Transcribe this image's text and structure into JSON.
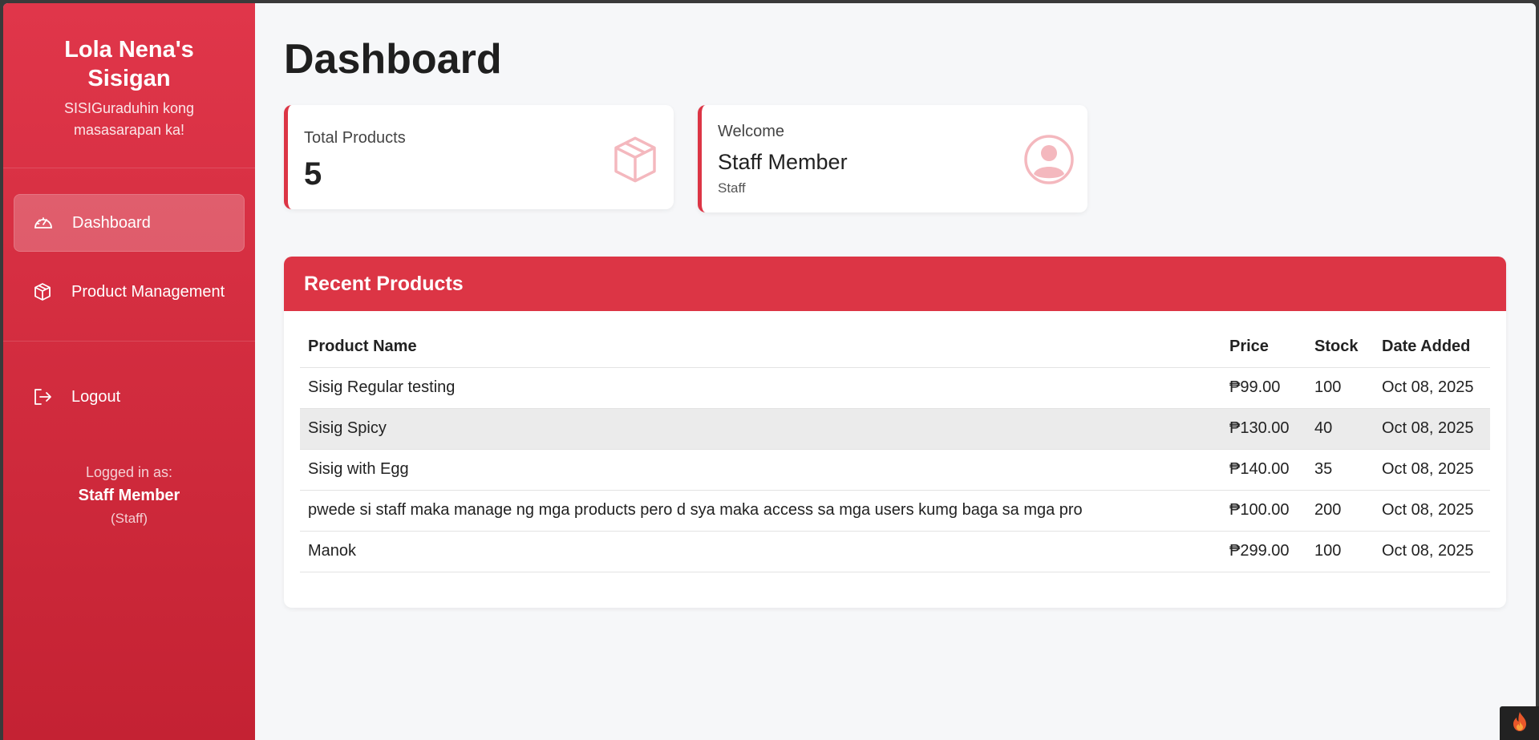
{
  "brand": {
    "title": "Lola Nena's Sisigan",
    "tagline": "SISIGuraduhin kong masasarapan ka!"
  },
  "nav": {
    "dashboard": "Dashboard",
    "product_management": "Product Management",
    "logout": "Logout"
  },
  "user": {
    "logged_in_as": "Logged in as:",
    "name": "Staff Member",
    "role_paren": "(Staff)"
  },
  "page": {
    "title": "Dashboard"
  },
  "cards": {
    "total_products": {
      "label": "Total Products",
      "value": "5"
    },
    "welcome": {
      "label": "Welcome",
      "name": "Staff Member",
      "role": "Staff"
    }
  },
  "recent_products": {
    "title": "Recent Products",
    "columns": [
      "Product Name",
      "Price",
      "Stock",
      "Date Added"
    ],
    "rows": [
      [
        "Sisig Regular testing",
        "₱99.00",
        "100",
        "Oct 08, 2025"
      ],
      [
        "Sisig Spicy",
        "₱130.00",
        "40",
        "Oct 08, 2025"
      ],
      [
        "Sisig with Egg",
        "₱140.00",
        "35",
        "Oct 08, 2025"
      ],
      [
        "pwede si staff maka manage ng mga products pero d sya maka access sa mga users kumg baga sa mga pro",
        "₱100.00",
        "200",
        "Oct 08, 2025"
      ],
      [
        "Manok",
        "₱299.00",
        "100",
        "Oct 08, 2025"
      ]
    ]
  },
  "colors": {
    "accent": "#dc3545",
    "sidebar_top": "#e0364a",
    "sidebar_bottom": "#c42233",
    "icon_tint": "#f4b8be"
  },
  "icons": {
    "dashboard": "speedometer-icon",
    "product": "box-icon",
    "logout": "logout-icon",
    "total_products": "box-icon",
    "welcome": "user-circle-icon",
    "corner": "flame-icon"
  }
}
